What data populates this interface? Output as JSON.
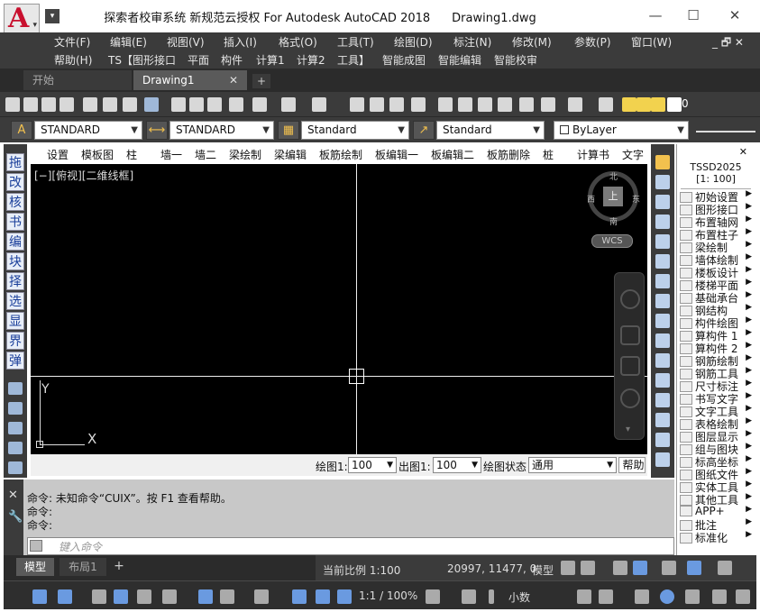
{
  "window": {
    "title_app": "探索者校审系统 新规范云授权 For Autodesk AutoCAD 2018",
    "title_doc": "Drawing1.dwg",
    "min": "—",
    "max": "☐",
    "close": "✕"
  },
  "menu_row1": [
    "文件(F)",
    "编辑(E)",
    "视图(V)",
    "插入(I)",
    "格式(O)",
    "工具(T)",
    "绘图(D)",
    "标注(N)",
    "修改(M)",
    "参数(P)",
    "窗口(W)"
  ],
  "menu_row2": [
    "帮助(H)",
    "TS【图形接口",
    "平面",
    "构件",
    "计算1",
    "计算2",
    "工具】",
    "智能成图",
    "智能编辑",
    "智能校审"
  ],
  "doc_controls": "_ 🗗 ✕",
  "tabs": {
    "start": "开始",
    "doc": "Drawing1",
    "close": "✕",
    "add": "+"
  },
  "toolbar2": {
    "text_style": "STANDARD",
    "dim_style": "STANDARD",
    "table_style": "Standard",
    "mleader_style": "Standard",
    "layer": "ByLayer"
  },
  "layer_num": "0",
  "left_chars": [
    "拖",
    "改",
    "核",
    "书",
    "编",
    "块",
    "择",
    "选",
    "显",
    "界",
    "弹"
  ],
  "ribbon": [
    "设置",
    "模板图",
    "柱",
    "墙一",
    "墙二",
    "梁绘制",
    "梁编辑",
    "板筋绘制",
    "板编辑一",
    "板编辑二",
    "板筋删除",
    "桩",
    "计算书",
    "文字"
  ],
  "viewport_label": "[−][俯视][二维线框]",
  "viewcube": {
    "top": "上",
    "n": "北",
    "s": "南",
    "w": "西",
    "e": "东",
    "wcs": "WCS"
  },
  "ucs": {
    "x": "X",
    "y": "Y"
  },
  "canvas_bar": {
    "draw_label": "绘图1:",
    "draw_value": "100",
    "out_label": "出图1:",
    "out_value": "100",
    "state_label": "绘图状态",
    "state_value": "通用",
    "help": "帮助"
  },
  "panel": {
    "title": "TSSD2025",
    "scale": "[1: 100]",
    "items": [
      "初始设置",
      "图形接口",
      "布置轴网",
      "布置柱子",
      "梁绘制",
      "墙体绘制",
      "楼板设计",
      "楼梯平面",
      "基础承台",
      "钢结构",
      "构件绘图",
      "算构件 1",
      "算构件 2",
      "钢筋绘制",
      "钢筋工具",
      "尺寸标注",
      "书写文字",
      "文字工具",
      "表格绘制",
      "图层显示",
      "组与图块",
      "标高坐标",
      "图纸文件",
      "实体工具",
      "其他工具",
      "APP+",
      "批注",
      "标准化"
    ]
  },
  "command": {
    "lines": [
      "命令: 未知命令“CUIX”。按 F1 查看帮助。",
      "命令:",
      "命令:"
    ],
    "placeholder": "键入命令"
  },
  "layout_tabs": {
    "model": "模型",
    "layout1": "布局1",
    "add": "+"
  },
  "status": {
    "scale": "当前比例 1:100",
    "coords": "20997, 11477, 0",
    "space": "模型",
    "annotation_scale": "1:1 / 100%",
    "units": "小数"
  },
  "colors": {
    "accent": "#2d6bd6",
    "dark_bg": "#3b3b3b",
    "canvas": "#000000"
  }
}
